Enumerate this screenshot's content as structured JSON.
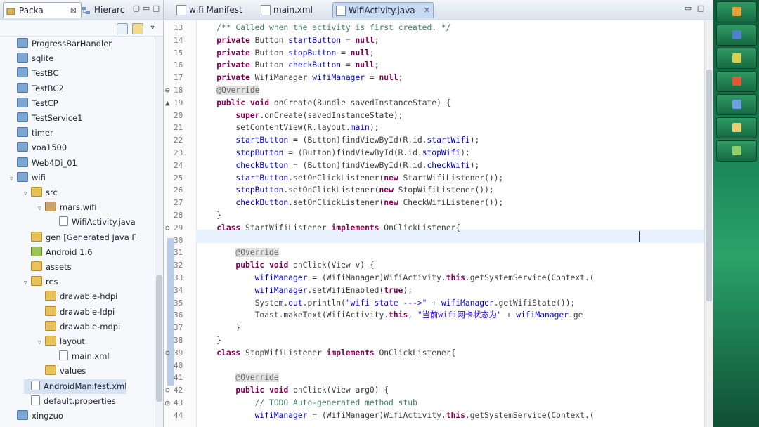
{
  "left_panel": {
    "tabs": [
      {
        "label": "Packa",
        "close": "⊠"
      },
      {
        "label": "Hierarc",
        "close": ""
      }
    ],
    "window_buttons": [
      "▢",
      "▭",
      "□"
    ],
    "tree": [
      {
        "label": "ProgressBarHandler",
        "type": "proj",
        "indent": 0,
        "twisty": ""
      },
      {
        "label": "sqlite",
        "type": "proj",
        "indent": 0,
        "twisty": ""
      },
      {
        "label": "TestBC",
        "type": "proj",
        "indent": 0,
        "twisty": ""
      },
      {
        "label": "TestBC2",
        "type": "proj",
        "indent": 0,
        "twisty": ""
      },
      {
        "label": "TestCP",
        "type": "proj",
        "indent": 0,
        "twisty": ""
      },
      {
        "label": "TestService1",
        "type": "proj",
        "indent": 0,
        "twisty": ""
      },
      {
        "label": "timer",
        "type": "proj",
        "indent": 0,
        "twisty": ""
      },
      {
        "label": "voa1500",
        "type": "proj",
        "indent": 0,
        "twisty": ""
      },
      {
        "label": "Web4Di_01",
        "type": "proj",
        "indent": 0,
        "twisty": ""
      },
      {
        "label": "wifi",
        "type": "proj",
        "indent": 0,
        "twisty": "▿"
      },
      {
        "label": "src",
        "type": "folder",
        "indent": 1,
        "twisty": "▿"
      },
      {
        "label": "mars.wifi",
        "type": "pkg",
        "indent": 2,
        "twisty": "▿"
      },
      {
        "label": "WifiActivity.java",
        "type": "file",
        "indent": 3,
        "twisty": ""
      },
      {
        "label": "gen [Generated Java F",
        "type": "folder",
        "indent": 1,
        "twisty": ""
      },
      {
        "label": "Android 1.6",
        "type": "android",
        "indent": 1,
        "twisty": ""
      },
      {
        "label": "assets",
        "type": "folder",
        "indent": 1,
        "twisty": ""
      },
      {
        "label": "res",
        "type": "folder",
        "indent": 1,
        "twisty": "▿"
      },
      {
        "label": "drawable-hdpi",
        "type": "folder",
        "indent": 2,
        "twisty": ""
      },
      {
        "label": "drawable-ldpi",
        "type": "folder",
        "indent": 2,
        "twisty": ""
      },
      {
        "label": "drawable-mdpi",
        "type": "folder",
        "indent": 2,
        "twisty": ""
      },
      {
        "label": "layout",
        "type": "folder",
        "indent": 2,
        "twisty": "▿"
      },
      {
        "label": "main.xml",
        "type": "file",
        "indent": 3,
        "twisty": ""
      },
      {
        "label": "values",
        "type": "folder",
        "indent": 2,
        "twisty": ""
      },
      {
        "label": "AndroidManifest.xml",
        "type": "file",
        "indent": 1,
        "twisty": "",
        "selected": true
      },
      {
        "label": "default.properties",
        "type": "file",
        "indent": 1,
        "twisty": ""
      },
      {
        "label": "xingzuo",
        "type": "proj",
        "indent": 0,
        "twisty": ""
      }
    ]
  },
  "editor": {
    "tabs": [
      {
        "label": "wifi Manifest",
        "active": false
      },
      {
        "label": "main.xml",
        "active": false
      },
      {
        "label": "WifiActivity.java",
        "active": true
      }
    ],
    "window_buttons": [
      "▭",
      "□"
    ],
    "lines": [
      {
        "n": "13",
        "mark": "",
        "parts": [
          {
            "t": "    /** Called when the activity is first created. */",
            "c": "cmt"
          }
        ]
      },
      {
        "n": "14",
        "mark": "",
        "parts": [
          {
            "t": "    ",
            "c": ""
          },
          {
            "t": "private",
            "c": "kw"
          },
          {
            "t": " Button ",
            "c": ""
          },
          {
            "t": "startButton",
            "c": "fld"
          },
          {
            "t": " = ",
            "c": ""
          },
          {
            "t": "null",
            "c": "kw"
          },
          {
            "t": ";",
            "c": ""
          }
        ]
      },
      {
        "n": "15",
        "mark": "",
        "parts": [
          {
            "t": "    ",
            "c": ""
          },
          {
            "t": "private",
            "c": "kw"
          },
          {
            "t": " Button ",
            "c": ""
          },
          {
            "t": "stopButton",
            "c": "fld"
          },
          {
            "t": " = ",
            "c": ""
          },
          {
            "t": "null",
            "c": "kw"
          },
          {
            "t": ";",
            "c": ""
          }
        ]
      },
      {
        "n": "16",
        "mark": "",
        "parts": [
          {
            "t": "    ",
            "c": ""
          },
          {
            "t": "private",
            "c": "kw"
          },
          {
            "t": " Button ",
            "c": ""
          },
          {
            "t": "checkButton",
            "c": "fld"
          },
          {
            "t": " = ",
            "c": ""
          },
          {
            "t": "null",
            "c": "kw"
          },
          {
            "t": ";",
            "c": ""
          }
        ]
      },
      {
        "n": "17",
        "mark": "",
        "parts": [
          {
            "t": "    ",
            "c": ""
          },
          {
            "t": "private",
            "c": "kw"
          },
          {
            "t": " WifiManager ",
            "c": ""
          },
          {
            "t": "wifiManager",
            "c": "fld"
          },
          {
            "t": " = ",
            "c": ""
          },
          {
            "t": "null",
            "c": "kw"
          },
          {
            "t": ";",
            "c": ""
          }
        ]
      },
      {
        "n": "18",
        "mark": "⊖",
        "parts": [
          {
            "t": "    ",
            "c": ""
          },
          {
            "t": "@Override",
            "c": "ann"
          }
        ]
      },
      {
        "n": "19",
        "mark": "▲",
        "parts": [
          {
            "t": "    ",
            "c": ""
          },
          {
            "t": "public",
            "c": "kw"
          },
          {
            "t": " ",
            "c": ""
          },
          {
            "t": "void",
            "c": "kw"
          },
          {
            "t": " onCreate(Bundle savedInstanceState) {",
            "c": ""
          }
        ]
      },
      {
        "n": "20",
        "mark": "",
        "parts": [
          {
            "t": "        ",
            "c": ""
          },
          {
            "t": "super",
            "c": "kw"
          },
          {
            "t": ".onCreate(savedInstanceState);",
            "c": ""
          }
        ]
      },
      {
        "n": "21",
        "mark": "",
        "parts": [
          {
            "t": "        setContentView(R.layout.",
            "c": ""
          },
          {
            "t": "main",
            "c": "fld"
          },
          {
            "t": ");",
            "c": ""
          }
        ]
      },
      {
        "n": "22",
        "mark": "",
        "parts": [
          {
            "t": "        ",
            "c": ""
          },
          {
            "t": "startButton",
            "c": "fld"
          },
          {
            "t": " = (Button)findViewById(R.id.",
            "c": ""
          },
          {
            "t": "startWifi",
            "c": "fld"
          },
          {
            "t": ");",
            "c": ""
          }
        ]
      },
      {
        "n": "23",
        "mark": "",
        "parts": [
          {
            "t": "        ",
            "c": ""
          },
          {
            "t": "stopButton",
            "c": "fld"
          },
          {
            "t": " = (Button)findViewById(R.id.",
            "c": ""
          },
          {
            "t": "stopWifi",
            "c": "fld"
          },
          {
            "t": ");",
            "c": ""
          }
        ]
      },
      {
        "n": "24",
        "mark": "",
        "parts": [
          {
            "t": "        ",
            "c": ""
          },
          {
            "t": "checkButton",
            "c": "fld"
          },
          {
            "t": " = (Button)findViewById(R.id.",
            "c": ""
          },
          {
            "t": "checkWifi",
            "c": "fld"
          },
          {
            "t": ");",
            "c": ""
          }
        ]
      },
      {
        "n": "25",
        "mark": "",
        "parts": [
          {
            "t": "        ",
            "c": ""
          },
          {
            "t": "startButton",
            "c": "fld"
          },
          {
            "t": ".setOnClickListener(",
            "c": ""
          },
          {
            "t": "new",
            "c": "kw"
          },
          {
            "t": " StartWifiListener());",
            "c": ""
          }
        ]
      },
      {
        "n": "26",
        "mark": "",
        "parts": [
          {
            "t": "        ",
            "c": ""
          },
          {
            "t": "stopButton",
            "c": "fld"
          },
          {
            "t": ".setOnClickListener(",
            "c": ""
          },
          {
            "t": "new",
            "c": "kw"
          },
          {
            "t": " StopWifiListener());",
            "c": ""
          }
        ]
      },
      {
        "n": "27",
        "mark": "",
        "parts": [
          {
            "t": "        ",
            "c": ""
          },
          {
            "t": "checkButton",
            "c": "fld"
          },
          {
            "t": ".setOnClickListener(",
            "c": ""
          },
          {
            "t": "new",
            "c": "kw"
          },
          {
            "t": " CheckWifiListener());",
            "c": ""
          }
        ]
      },
      {
        "n": "28",
        "mark": "",
        "parts": [
          {
            "t": "    }",
            "c": ""
          }
        ]
      },
      {
        "n": "29",
        "mark": "⊖",
        "parts": [
          {
            "t": "    ",
            "c": ""
          },
          {
            "t": "class",
            "c": "kw"
          },
          {
            "t": " StartWifiListener ",
            "c": ""
          },
          {
            "t": "implements",
            "c": "kw"
          },
          {
            "t": " OnClickListener{",
            "c": ""
          }
        ]
      },
      {
        "n": "30",
        "mark": "",
        "parts": [
          {
            "t": "",
            "c": ""
          }
        ]
      },
      {
        "n": "31",
        "mark": "",
        "parts": [
          {
            "t": "        ",
            "c": ""
          },
          {
            "t": "@Override",
            "c": "ann"
          }
        ]
      },
      {
        "n": "32",
        "mark": "",
        "parts": [
          {
            "t": "        ",
            "c": ""
          },
          {
            "t": "public",
            "c": "kw"
          },
          {
            "t": " ",
            "c": ""
          },
          {
            "t": "void",
            "c": "kw"
          },
          {
            "t": " onClick(View v) {",
            "c": ""
          }
        ]
      },
      {
        "n": "33",
        "mark": "",
        "parts": [
          {
            "t": "            ",
            "c": ""
          },
          {
            "t": "wifiManager",
            "c": "fld"
          },
          {
            "t": " = (WifiManager)WifiActivity.",
            "c": ""
          },
          {
            "t": "this",
            "c": "kw"
          },
          {
            "t": ".getSystemService(Context.(",
            "c": ""
          }
        ]
      },
      {
        "n": "34",
        "mark": "",
        "parts": [
          {
            "t": "            ",
            "c": ""
          },
          {
            "t": "wifiManager",
            "c": "fld"
          },
          {
            "t": ".setWifiEnabled(",
            "c": ""
          },
          {
            "t": "true",
            "c": "kw"
          },
          {
            "t": ");",
            "c": ""
          }
        ]
      },
      {
        "n": "35",
        "mark": "",
        "parts": [
          {
            "t": "            System.",
            "c": ""
          },
          {
            "t": "out",
            "c": "fld"
          },
          {
            "t": ".println(",
            "c": ""
          },
          {
            "t": "\"wifi state --->\"",
            "c": "str"
          },
          {
            "t": " + ",
            "c": ""
          },
          {
            "t": "wifiManager",
            "c": "fld"
          },
          {
            "t": ".getWifiState());",
            "c": ""
          }
        ]
      },
      {
        "n": "36",
        "mark": "",
        "parts": [
          {
            "t": "            Toast.makeText(WifiActivity.",
            "c": ""
          },
          {
            "t": "this",
            "c": "kw"
          },
          {
            "t": ", ",
            "c": ""
          },
          {
            "t": "\"当前wifi网卡状态为\"",
            "c": "str"
          },
          {
            "t": " + ",
            "c": ""
          },
          {
            "t": "wifiManager",
            "c": "fld"
          },
          {
            "t": ".ge",
            "c": ""
          }
        ]
      },
      {
        "n": "37",
        "mark": "",
        "parts": [
          {
            "t": "        }",
            "c": ""
          }
        ]
      },
      {
        "n": "38",
        "mark": "",
        "parts": [
          {
            "t": "    }",
            "c": ""
          }
        ]
      },
      {
        "n": "39",
        "mark": "⊖",
        "parts": [
          {
            "t": "    ",
            "c": ""
          },
          {
            "t": "class",
            "c": "kw"
          },
          {
            "t": " StopWifiListener ",
            "c": ""
          },
          {
            "t": "implements",
            "c": "kw"
          },
          {
            "t": " OnClickListener{",
            "c": ""
          }
        ]
      },
      {
        "n": "40",
        "mark": "",
        "parts": [
          {
            "t": "",
            "c": ""
          }
        ]
      },
      {
        "n": "41",
        "mark": "",
        "parts": [
          {
            "t": "        ",
            "c": ""
          },
          {
            "t": "@Override",
            "c": "ann"
          }
        ]
      },
      {
        "n": "42",
        "mark": "⊖",
        "parts": [
          {
            "t": "        ",
            "c": ""
          },
          {
            "t": "public",
            "c": "kw"
          },
          {
            "t": " ",
            "c": ""
          },
          {
            "t": "void",
            "c": "kw"
          },
          {
            "t": " onClick(View arg0) {",
            "c": ""
          }
        ]
      },
      {
        "n": "43",
        "mark": "◎",
        "parts": [
          {
            "t": "            ",
            "c": ""
          },
          {
            "t": "// TODO Auto-generated method stub",
            "c": "cmt"
          }
        ]
      },
      {
        "n": "44",
        "mark": "",
        "parts": [
          {
            "t": "            ",
            "c": ""
          },
          {
            "t": "wifiManager",
            "c": "fld"
          },
          {
            "t": " = (WifiManager)WifiActivity.",
            "c": ""
          },
          {
            "t": "this",
            "c": "kw"
          },
          {
            "t": ".getSystemService(Context.(",
            "c": ""
          }
        ]
      }
    ]
  },
  "colors": {
    "keyword": "#7f0055",
    "field": "#0000c0",
    "string": "#2a00ff",
    "comment": "#3f7f5f",
    "desktop_green": "#1c8a5a"
  },
  "desktop_icons": [
    "gear-icon",
    "folder-icon",
    "app-icon",
    "app-icon",
    "doc-icon",
    "app-icon",
    "app-icon"
  ]
}
